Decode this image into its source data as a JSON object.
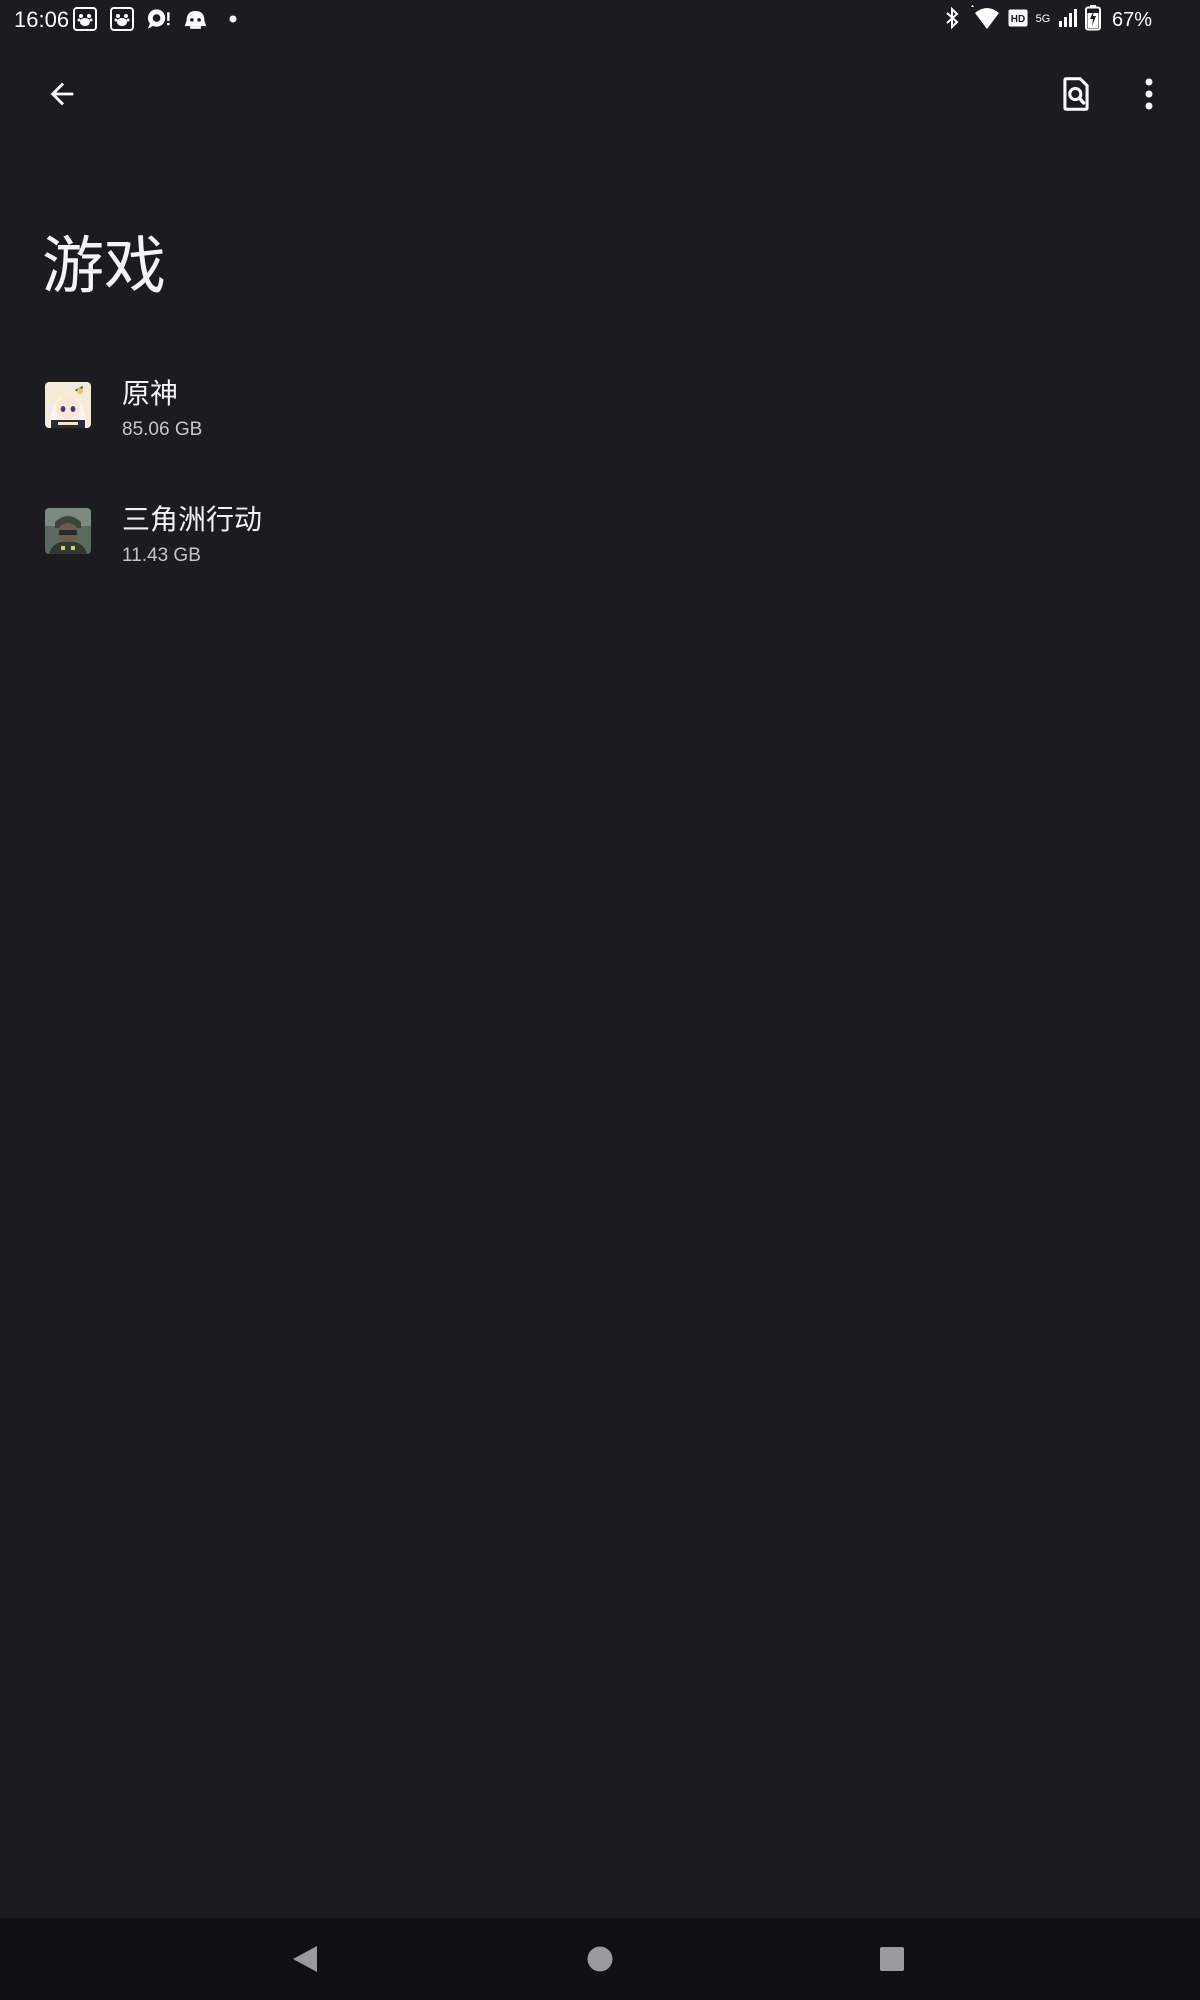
{
  "status_bar": {
    "time": "16:06",
    "battery_percent": "67%",
    "network_badge_hd": "HD",
    "network_badge_5g": "5G",
    "left_icons": [
      "baidu-netdisk-icon",
      "baidu-netdisk-icon",
      "chat-bubble-icon",
      "app-character-icon",
      "dot-icon"
    ],
    "right_icons": [
      "bluetooth-icon",
      "wifi-icon",
      "hd-icon",
      "5g-icon",
      "signal-icon",
      "battery-charging-icon"
    ]
  },
  "app_bar": {
    "back_icon": "arrow-back-icon",
    "search_icon": "file-search-icon",
    "more_icon": "more-vert-icon"
  },
  "page": {
    "title": "游戏"
  },
  "apps": [
    {
      "name": "原神",
      "size": "85.06 GB",
      "icon": "genshin-app-icon"
    },
    {
      "name": "三角洲行动",
      "size": "11.43 GB",
      "icon": "delta-force-app-icon"
    }
  ],
  "nav_bar": {
    "back_icon": "nav-back-triangle-icon",
    "home_icon": "nav-home-circle-icon",
    "recent_icon": "nav-recent-square-icon"
  },
  "colors": {
    "background": "#1c1b20",
    "nav_background": "#101012",
    "primary_text": "#f2f1f6",
    "secondary_text": "#c6c4cc"
  }
}
